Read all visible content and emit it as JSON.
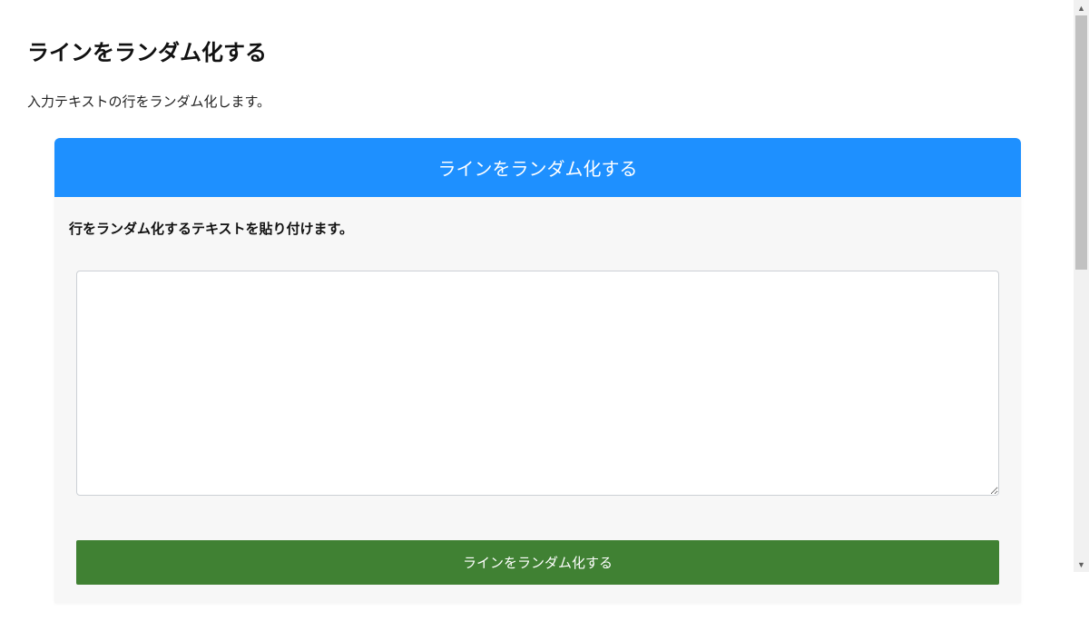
{
  "page": {
    "title": "ラインをランダム化する",
    "description": "入力テキストの行をランダム化します。"
  },
  "card": {
    "header": "ラインをランダム化する",
    "input_label": "行をランダム化するテキストを貼り付けます。",
    "textarea_value": "",
    "button_label": "ラインをランダム化する"
  },
  "colors": {
    "header_bg": "#1e90ff",
    "button_bg": "#408133"
  }
}
